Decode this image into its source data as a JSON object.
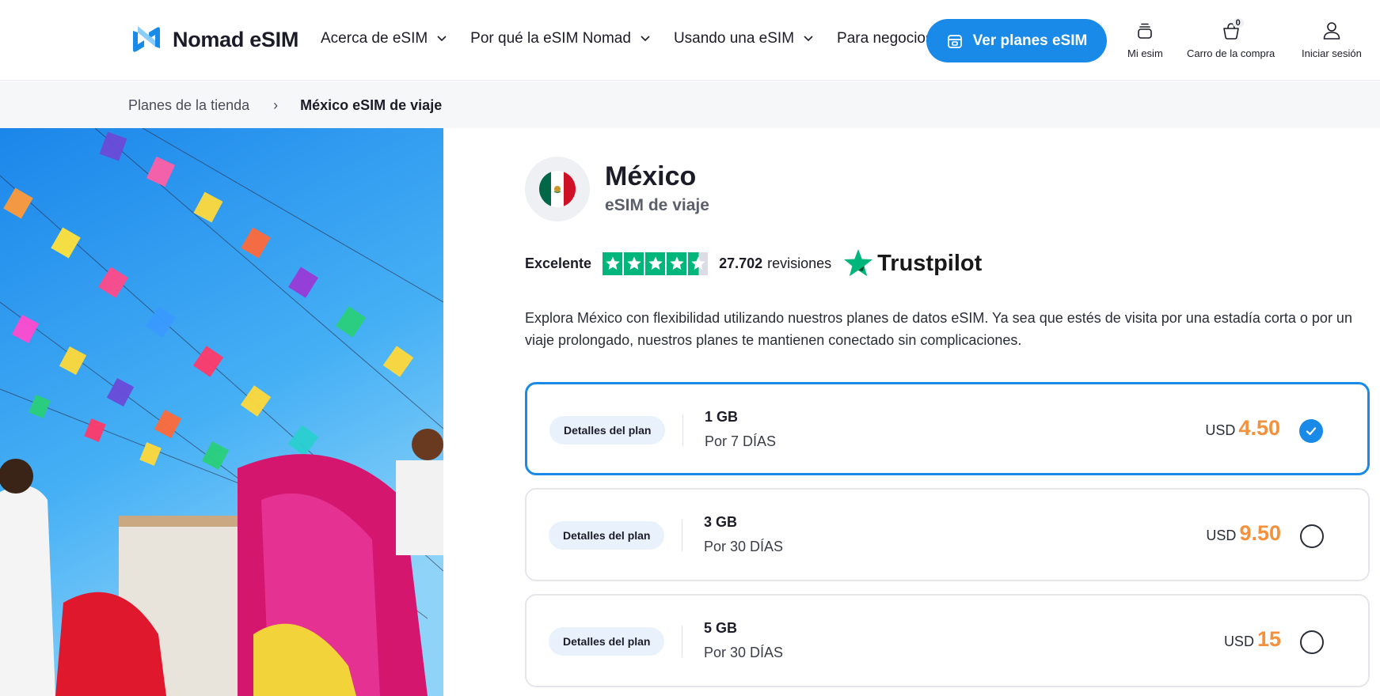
{
  "brand": {
    "name": "Nomad eSIM",
    "accent": "#1a8ae8"
  },
  "nav": {
    "items": [
      {
        "label": "Acerca de eSIM",
        "dropdown": true
      },
      {
        "label": "Por qué la eSIM Nomad",
        "dropdown": true
      },
      {
        "label": "Usando una eSIM",
        "dropdown": true
      },
      {
        "label": "Para negocios",
        "dropdown": false
      }
    ],
    "cta": "Ver planes eSIM",
    "my_esim": "Mi esim",
    "cart": "Carro de la compra",
    "cart_count": "0",
    "login": "Iniciar sesión"
  },
  "breadcrumb": {
    "parent": "Planes de la tienda",
    "separator": "›",
    "current": "México eSIM de viaje"
  },
  "product": {
    "country": "México",
    "subtitle": "eSIM de viaje",
    "flag_colors": [
      "#006847",
      "#ffffff",
      "#ce1126"
    ]
  },
  "rating": {
    "word": "Excelente",
    "stars": 4.5,
    "count": "27.702",
    "count_label": "revisiones",
    "provider": "Trustpilot",
    "star_color": "#00b67a"
  },
  "description": "Explora México con flexibilidad utilizando nuestros planes de datos eSIM. Ya sea que estés de visita por una estadía corta o por un viaje prolongado, nuestros planes te mantienen conectado sin complicaciones.",
  "plans": [
    {
      "details_label": "Detalles del plan",
      "data": "1 GB",
      "duration": "Por 7 DÍAS",
      "currency": "USD",
      "price": "4.50",
      "selected": true
    },
    {
      "details_label": "Detalles del plan",
      "data": "3 GB",
      "duration": "Por 30 DÍAS",
      "currency": "USD",
      "price": "9.50",
      "selected": false
    },
    {
      "details_label": "Detalles del plan",
      "data": "5 GB",
      "duration": "Por 30 DÍAS",
      "currency": "USD",
      "price": "15",
      "selected": false
    }
  ]
}
